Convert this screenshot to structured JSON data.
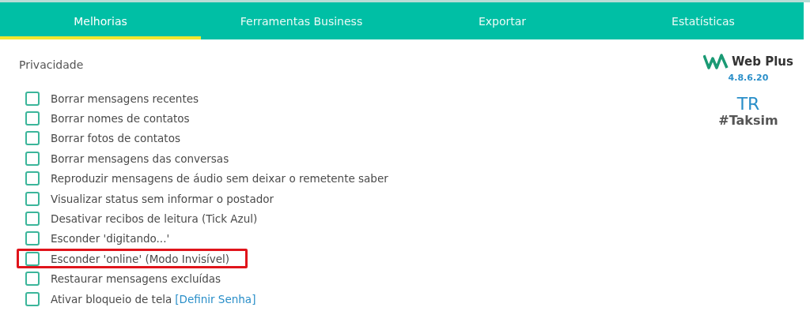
{
  "tabs": [
    {
      "label": "Melhorias",
      "selected": true
    },
    {
      "label": "Ferramentas Business",
      "selected": false
    },
    {
      "label": "Exportar",
      "selected": false
    },
    {
      "label": "Estatísticas",
      "selected": false
    }
  ],
  "section": {
    "title": "Privacidade"
  },
  "options": [
    {
      "label": "Borrar mensagens recentes",
      "checked": false,
      "highlighted": false
    },
    {
      "label": "Borrar nomes de contatos",
      "checked": false,
      "highlighted": false
    },
    {
      "label": "Borrar fotos de contatos",
      "checked": false,
      "highlighted": false
    },
    {
      "label": "Borrar mensagens das conversas",
      "checked": false,
      "highlighted": false
    },
    {
      "label": "Reproduzir mensagens de áudio sem deixar o remetente saber",
      "checked": false,
      "highlighted": false
    },
    {
      "label": "Visualizar status sem informar o postador",
      "checked": false,
      "highlighted": false
    },
    {
      "label": "Desativar recibos de leitura (Tick Azul)",
      "checked": false,
      "highlighted": false
    },
    {
      "label": "Esconder 'digitando...'",
      "checked": false,
      "highlighted": false
    },
    {
      "label": "Esconder 'online' (Modo Invisível)",
      "checked": false,
      "highlighted": true
    },
    {
      "label": "Restaurar mensagens excluídas",
      "checked": false,
      "highlighted": false
    },
    {
      "label": "Ativar bloqueio de tela",
      "checked": false,
      "highlighted": false,
      "link": "[Definir Senha]"
    }
  ],
  "brand": {
    "name": "Web Plus",
    "version": "4.8.6.20",
    "region": "TR",
    "tag": "#Taksim"
  }
}
